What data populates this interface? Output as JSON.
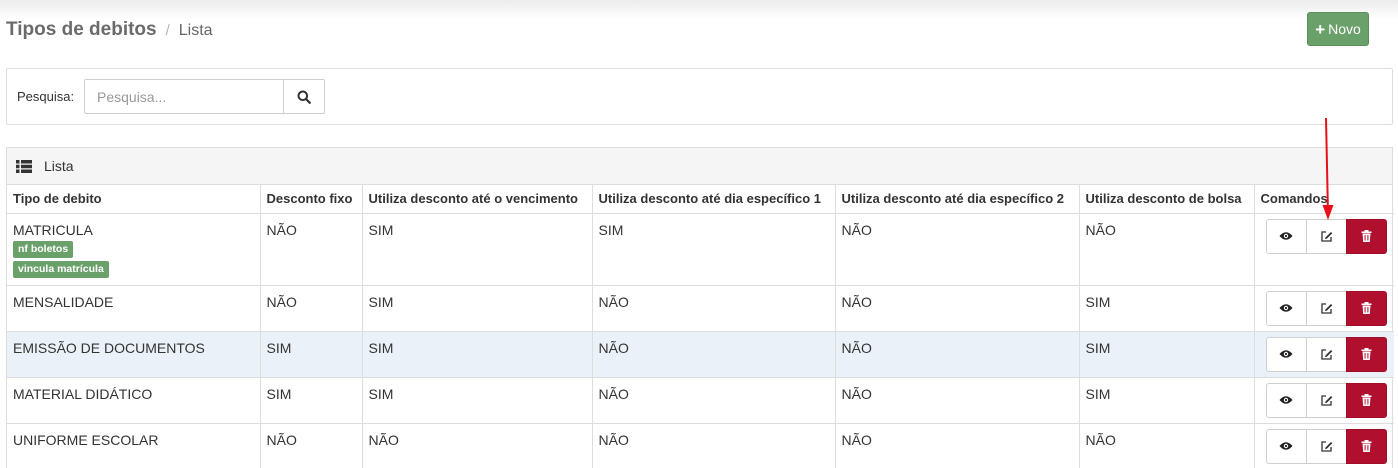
{
  "breadcrumb": {
    "title": "Tipos de debitos",
    "separator": "/",
    "current": "Lista"
  },
  "toolbar": {
    "new_label": "Novo"
  },
  "search": {
    "label": "Pesquisa:",
    "placeholder": "Pesquisa...",
    "value": ""
  },
  "list": {
    "title": "Lista",
    "columns": [
      "Tipo de debito",
      "Desconto fixo",
      "Utiliza desconto até o vencimento",
      "Utiliza desconto até dia específico 1",
      "Utiliza desconto até dia específico 2",
      "Utiliza desconto de bolsa",
      "Comandos"
    ],
    "rows": [
      {
        "tipo": "MATRICULA",
        "badges": [
          "nf boletos",
          "vincula matrícula"
        ],
        "desconto_fixo": "NÃO",
        "vencimento": "SIM",
        "dia1": "SIM",
        "dia2": "NÃO",
        "bolsa": "NÃO"
      },
      {
        "tipo": "MENSALIDADE",
        "desconto_fixo": "NÃO",
        "vencimento": "SIM",
        "dia1": "NÃO",
        "dia2": "NÃO",
        "bolsa": "SIM"
      },
      {
        "tipo": "EMISSÃO DE DOCUMENTOS",
        "desconto_fixo": "SIM",
        "vencimento": "SIM",
        "dia1": "NÃO",
        "dia2": "NÃO",
        "bolsa": "SIM"
      },
      {
        "tipo": "MATERIAL DIDÁTICO",
        "desconto_fixo": "SIM",
        "vencimento": "SIM",
        "dia1": "NÃO",
        "dia2": "NÃO",
        "bolsa": "SIM"
      },
      {
        "tipo": "UNIFORME ESCOLAR",
        "desconto_fixo": "NÃO",
        "vencimento": "NÃO",
        "dia1": "NÃO",
        "dia2": "NÃO",
        "bolsa": "NÃO"
      }
    ]
  },
  "icons": {
    "new": "plus-icon",
    "search": "search-icon",
    "list": "list-icon",
    "view": "eye-icon",
    "edit": "edit-icon",
    "delete": "trash-icon"
  },
  "colors": {
    "primary_green": "#6aa06a",
    "danger": "#b0102d",
    "row_highlight": "#eaf1f8",
    "annotation_arrow": "#e8101a"
  }
}
